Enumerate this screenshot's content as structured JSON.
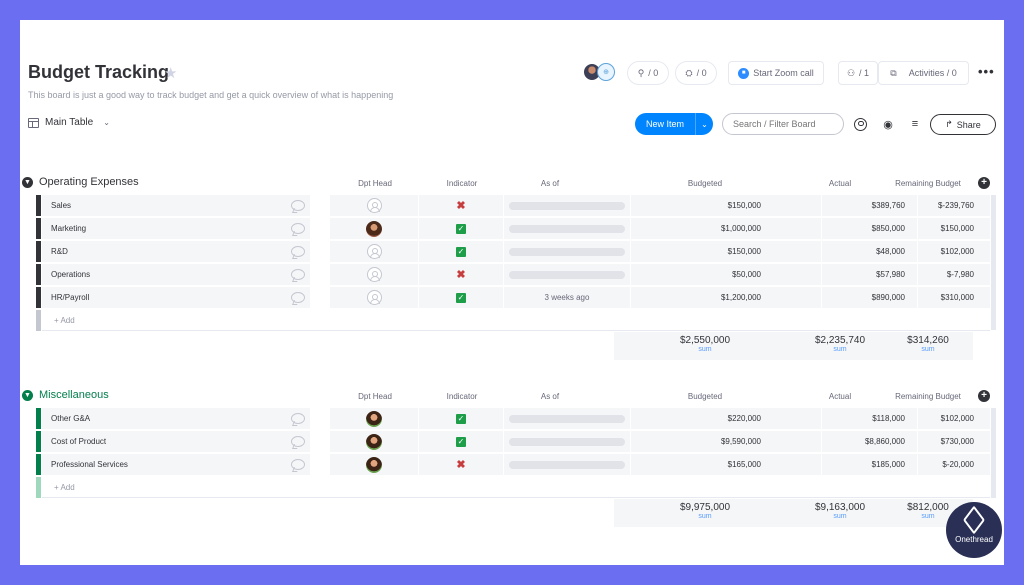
{
  "board": {
    "title": "Budget Tracking",
    "description": "This board is just a good way to track budget and get a quick overview of what is happening"
  },
  "header": {
    "updates_count": "/ 0",
    "integrations_count": "/ 0",
    "zoom_label": "Start Zoom call",
    "members_count": "/ 1",
    "activities_label": "Activities / 0",
    "more": "•••"
  },
  "toolbar": {
    "view_label": "Main Table",
    "new_item_label": "New Item",
    "search_placeholder": "Search / Filter Board",
    "share_label": "Share"
  },
  "columns": {
    "dpt_head": "Dpt Head",
    "indicator": "Indicator",
    "as_of": "As of",
    "budgeted": "Budgeted",
    "actual": "Actual",
    "remaining": "Remaining Budget"
  },
  "colors": {
    "group1": "#323338",
    "group2": "#037f4c",
    "accent": "#0085ff"
  },
  "groups": [
    {
      "name": "Operating Expenses",
      "add_label": "+ Add",
      "rows": [
        {
          "name": "Sales",
          "dpt": "none",
          "indicator": "x",
          "as_of": "",
          "budgeted": "$150,000",
          "actual": "$389,760",
          "remaining": "$-239,760"
        },
        {
          "name": "Marketing",
          "dpt": "photo",
          "indicator": "check",
          "as_of": "",
          "budgeted": "$1,000,000",
          "actual": "$850,000",
          "remaining": "$150,000"
        },
        {
          "name": "R&D",
          "dpt": "none",
          "indicator": "check",
          "as_of": "",
          "budgeted": "$150,000",
          "actual": "$48,000",
          "remaining": "$102,000"
        },
        {
          "name": "Operations",
          "dpt": "none",
          "indicator": "x",
          "as_of": "",
          "budgeted": "$50,000",
          "actual": "$57,980",
          "remaining": "$-7,980"
        },
        {
          "name": "HR/Payroll",
          "dpt": "none",
          "indicator": "check",
          "as_of": "3 weeks ago",
          "budgeted": "$1,200,000",
          "actual": "$890,000",
          "remaining": "$310,000"
        }
      ],
      "totals": {
        "budgeted": "$2,550,000",
        "actual": "$2,235,740",
        "remaining": "$314,260",
        "unit": "sum"
      }
    },
    {
      "name": "Miscellaneous",
      "add_label": "+ Add",
      "rows": [
        {
          "name": "Other G&A",
          "dpt": "photo",
          "indicator": "check",
          "as_of": "",
          "budgeted": "$220,000",
          "actual": "$118,000",
          "remaining": "$102,000"
        },
        {
          "name": "Cost of Product",
          "dpt": "photo",
          "indicator": "check",
          "as_of": "",
          "budgeted": "$9,590,000",
          "actual": "$8,860,000",
          "remaining": "$730,000"
        },
        {
          "name": "Professional Services",
          "dpt": "photo",
          "indicator": "x",
          "as_of": "",
          "budgeted": "$165,000",
          "actual": "$185,000",
          "remaining": "$-20,000"
        }
      ],
      "totals": {
        "budgeted": "$9,975,000",
        "actual": "$9,163,000",
        "remaining": "$812,000",
        "unit": "sum"
      }
    }
  ],
  "watermark": {
    "name": "Onethread"
  }
}
